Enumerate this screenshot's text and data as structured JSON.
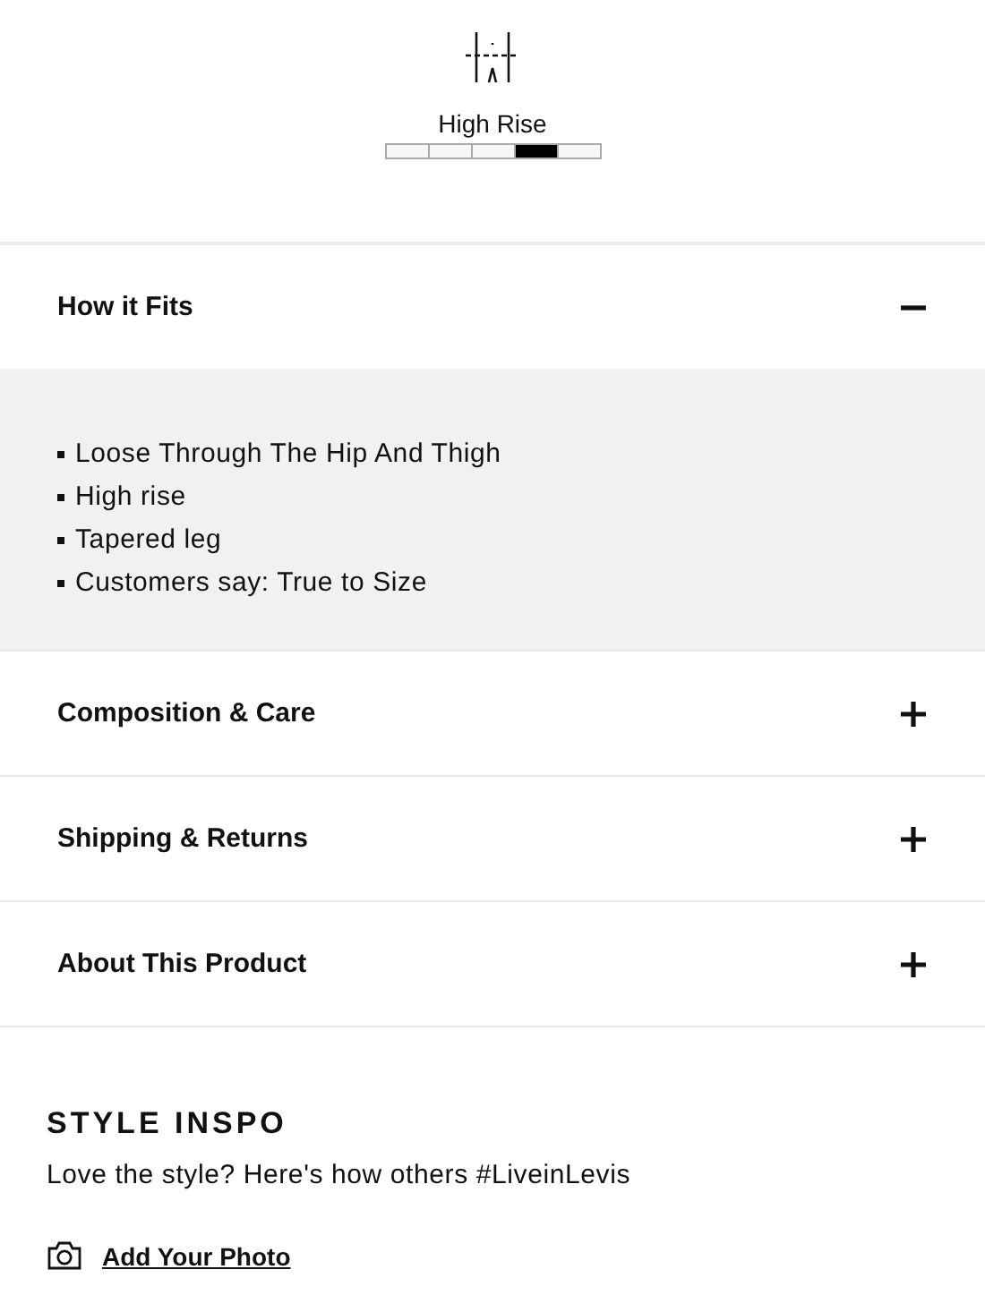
{
  "rise": {
    "label": "High Rise",
    "segments": [
      {
        "selected": false
      },
      {
        "selected": false
      },
      {
        "selected": false
      },
      {
        "selected": true
      },
      {
        "selected": false
      }
    ]
  },
  "accordion": [
    {
      "title": "How it Fits",
      "expanded": true,
      "bullets": [
        "Loose Through The Hip And Thigh",
        "High rise",
        "Tapered leg",
        "Customers say: True to Size"
      ]
    },
    {
      "title": "Composition & Care",
      "expanded": false
    },
    {
      "title": "Shipping & Returns",
      "expanded": false
    },
    {
      "title": "About This Product",
      "expanded": false
    }
  ],
  "style_inspo": {
    "heading": "STYLE INSPO",
    "text": "Love the style? Here's how others #LiveinLevis",
    "link": "Add Your Photo"
  }
}
